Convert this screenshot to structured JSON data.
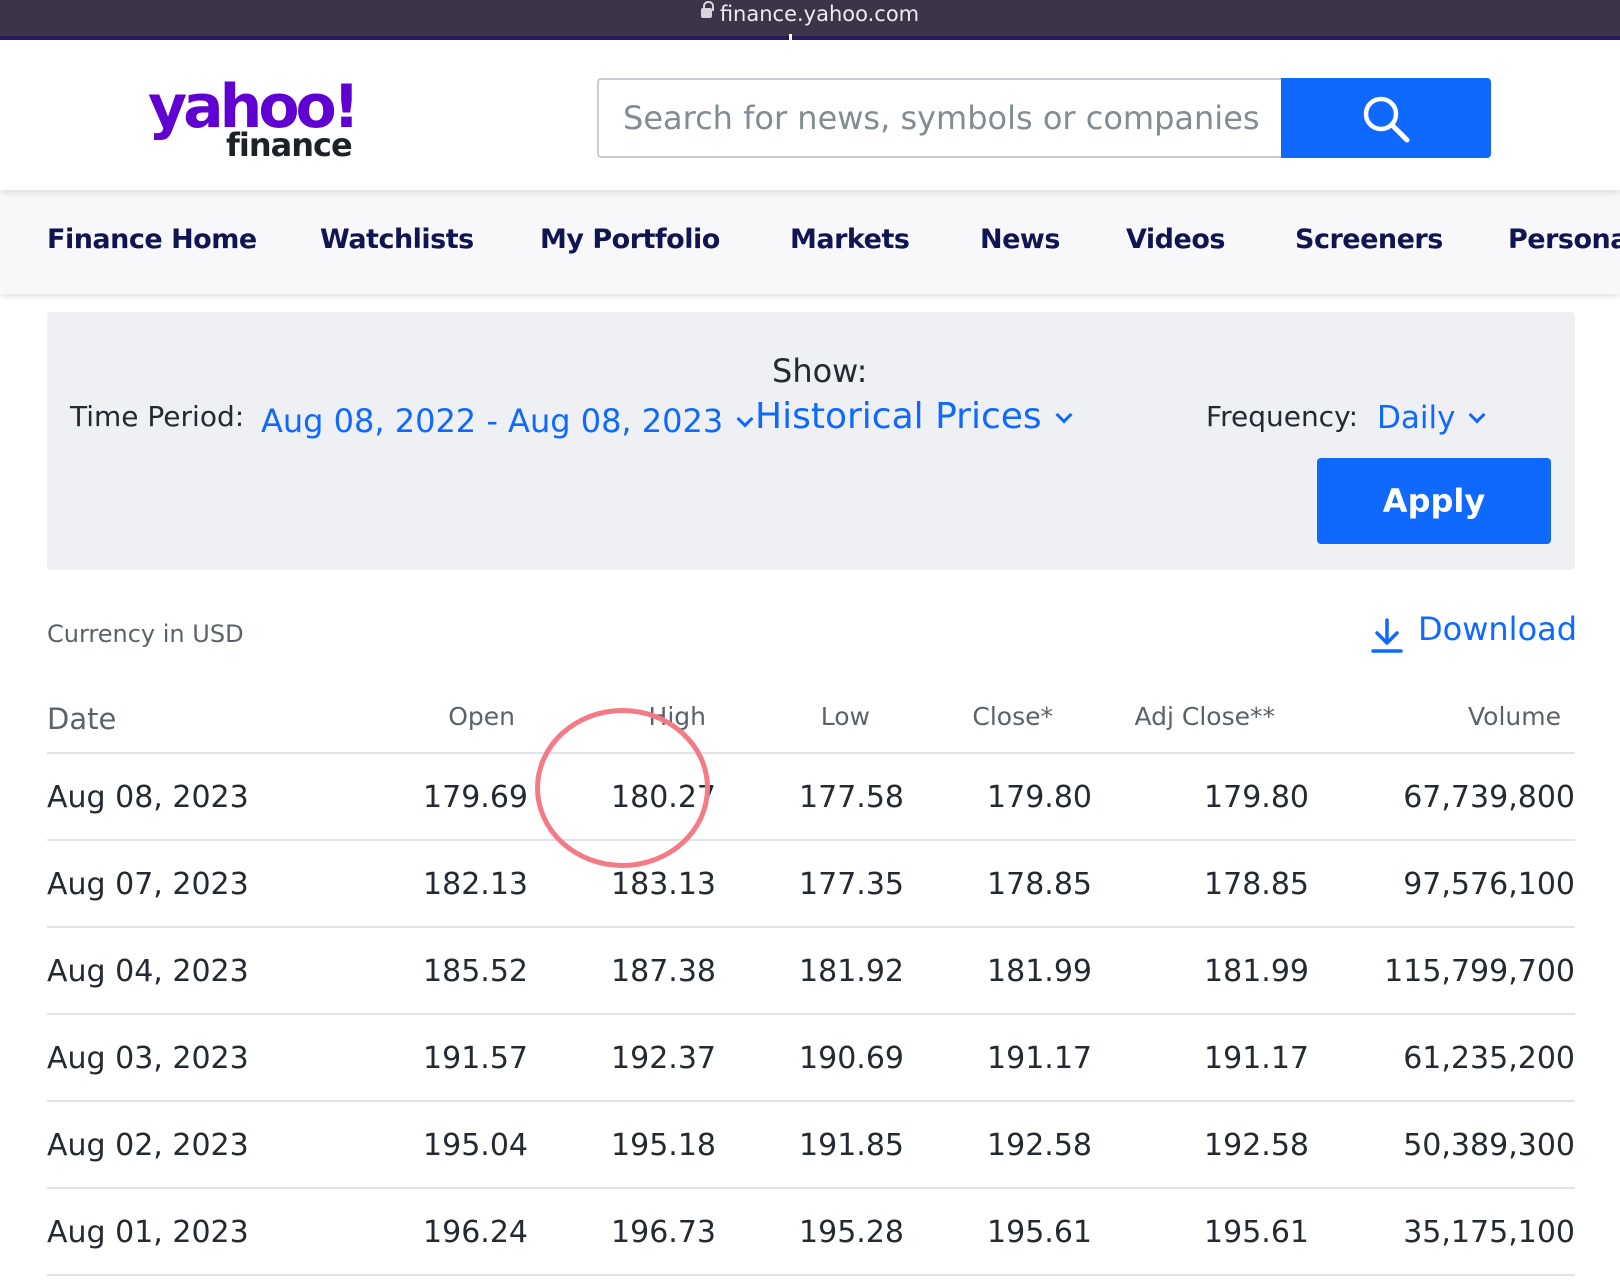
{
  "browser": {
    "url": "finance.yahoo.com"
  },
  "header": {
    "logo_top": "yahoo!",
    "logo_bottom": "finance",
    "search_placeholder": "Search for news, symbols or companies"
  },
  "nav": [
    "Finance Home",
    "Watchlists",
    "My Portfolio",
    "Markets",
    "News",
    "Videos",
    "Screeners",
    "Persona"
  ],
  "controls": {
    "time_period_label": "Time Period:",
    "time_period_value": "Aug 08, 2022 - Aug 08, 2023",
    "show_label": "Show:",
    "show_value": "Historical Prices",
    "frequency_label": "Frequency:",
    "frequency_value": "Daily",
    "apply_label": "Apply"
  },
  "currency": "Currency in USD",
  "download_label": "Download",
  "table": {
    "columns": [
      "Date",
      "Open",
      "High",
      "Low",
      "Close*",
      "Adj Close**",
      "Volume"
    ],
    "rows": [
      [
        "Aug 08, 2023",
        "179.69",
        "180.27",
        "177.58",
        "179.80",
        "179.80",
        "67,739,800"
      ],
      [
        "Aug 07, 2023",
        "182.13",
        "183.13",
        "177.35",
        "178.85",
        "178.85",
        "97,576,100"
      ],
      [
        "Aug 04, 2023",
        "185.52",
        "187.38",
        "181.92",
        "181.99",
        "181.99",
        "115,799,700"
      ],
      [
        "Aug 03, 2023",
        "191.57",
        "192.37",
        "190.69",
        "191.17",
        "191.17",
        "61,235,200"
      ],
      [
        "Aug 02, 2023",
        "195.04",
        "195.18",
        "191.85",
        "192.58",
        "192.58",
        "50,389,300"
      ],
      [
        "Aug 01, 2023",
        "196.24",
        "196.73",
        "195.28",
        "195.61",
        "195.61",
        "35,175,100"
      ]
    ]
  },
  "colors": {
    "brand": "#6001d2",
    "accent": "#0f69ff",
    "nav_text": "#101450",
    "highlight_circle": "#f47a86"
  }
}
